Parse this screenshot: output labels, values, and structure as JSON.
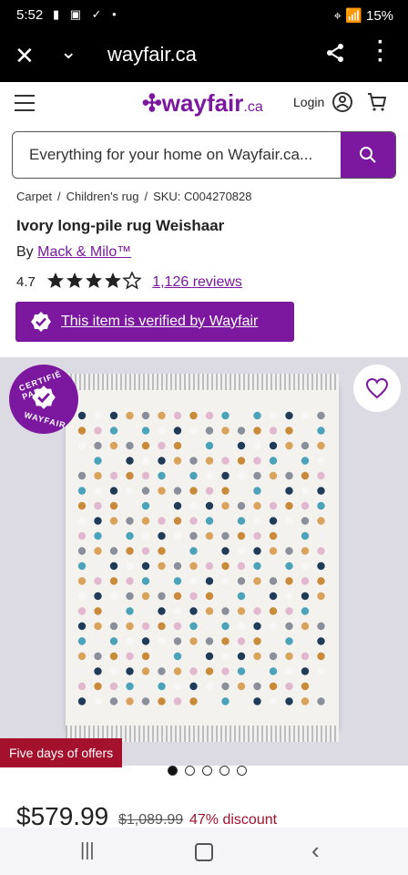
{
  "status": {
    "time": "5:52",
    "icons": "▮ ▣ ✓ •",
    "right": "⌖ 📶 15%"
  },
  "browser": {
    "close_icon": "close-icon",
    "chevron_icon": "chevron-down-icon",
    "url": "wayfair.ca",
    "share_icon": "share-icon",
    "more_icon": "more-vertical-icon"
  },
  "header": {
    "logo_text": "wayfair",
    "logo_suffix": ".ca",
    "login_label": "Login"
  },
  "search": {
    "placeholder": "Everything for your home on Wayfair.ca..."
  },
  "breadcrumb": {
    "items": [
      "Carpet",
      "Children's rug",
      "SKU: C004270828"
    ],
    "sep": "/"
  },
  "product": {
    "title": "Ivory long-pile rug Weishaar",
    "by_prefix": "By",
    "brand": "Mack & Milo™",
    "rating": "4.7",
    "reviews": "1,126 reviews",
    "verified": "This item is verified by Wayfair",
    "badge_top": "CERTIFIÉ PAR",
    "badge_bottom": "WAYFAIR",
    "offer": "Five days of offers",
    "price": "$579.99",
    "was_price": "$1,089.99",
    "discount": "47% discount",
    "carousel_active": 1,
    "carousel_count": 5
  },
  "colors": {
    "brand": "#7b189f",
    "offer": "#a3112d"
  },
  "navbar": {
    "recent": "|||",
    "back": "‹"
  }
}
